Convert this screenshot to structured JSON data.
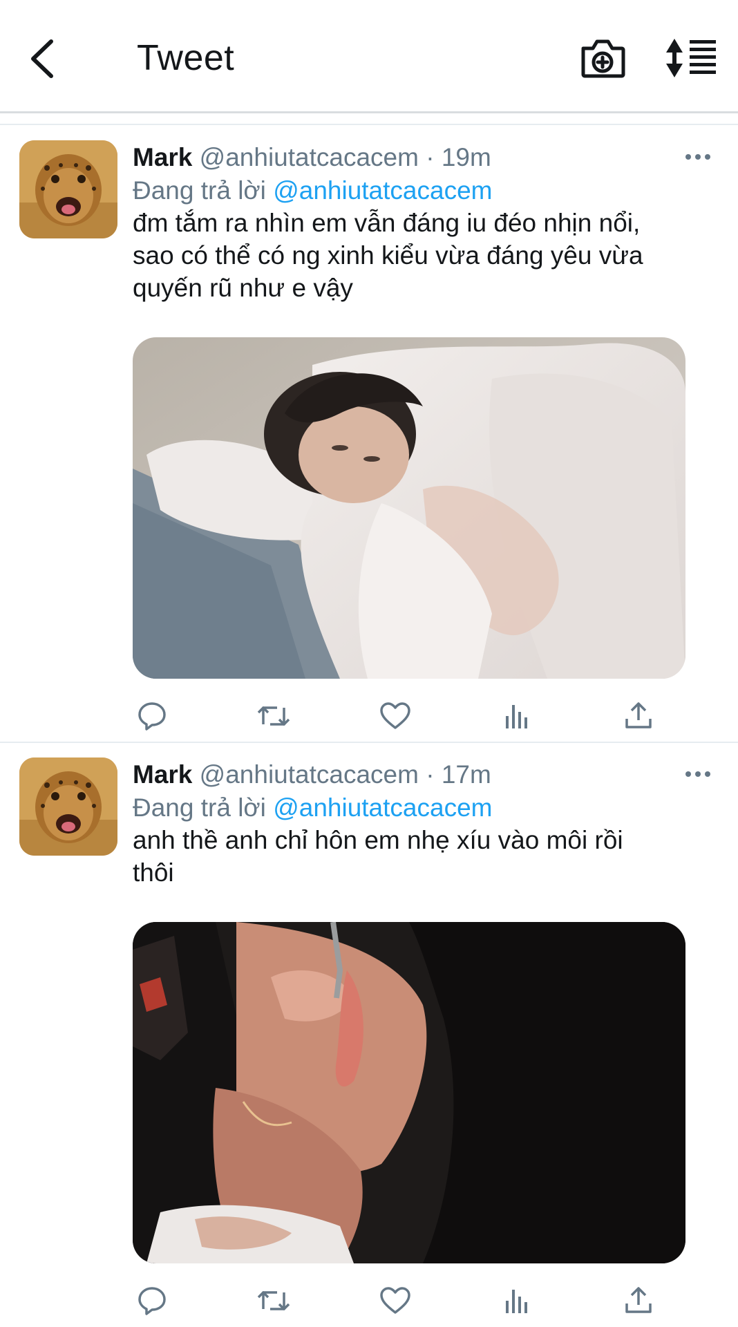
{
  "header": {
    "title": "Tweet",
    "back_icon": "chevron-left-icon",
    "camera_icon": "camera-plus-icon",
    "sort_icon": "sort-icon"
  },
  "tweets": [
    {
      "name": "Mark",
      "handle": "@anhiutatcacacem",
      "dot": "·",
      "time": "19m",
      "replying_prefix": "Đang trả lời",
      "replying_to": "@anhiutatcacacem",
      "text": "đm tắm ra nhìn em vẫn đáng iu đéo nhịn nổi,\nsao có thể có ng xinh kiểu vừa đáng yêu vừa\nquyến rũ như e vậy"
    },
    {
      "name": "Mark",
      "handle": "@anhiutatcacacem",
      "dot": "·",
      "time": "17m",
      "replying_prefix": "Đang trả lời",
      "replying_to": "@anhiutatcacacem",
      "text": "anh thề anh chỉ hôn em nhẹ xíu vào môi rồi\nthôi"
    }
  ],
  "colors": {
    "link": "#1da1f2",
    "secondary_text": "#657786",
    "icon": "#657786",
    "divider": "#e6ecf0"
  }
}
